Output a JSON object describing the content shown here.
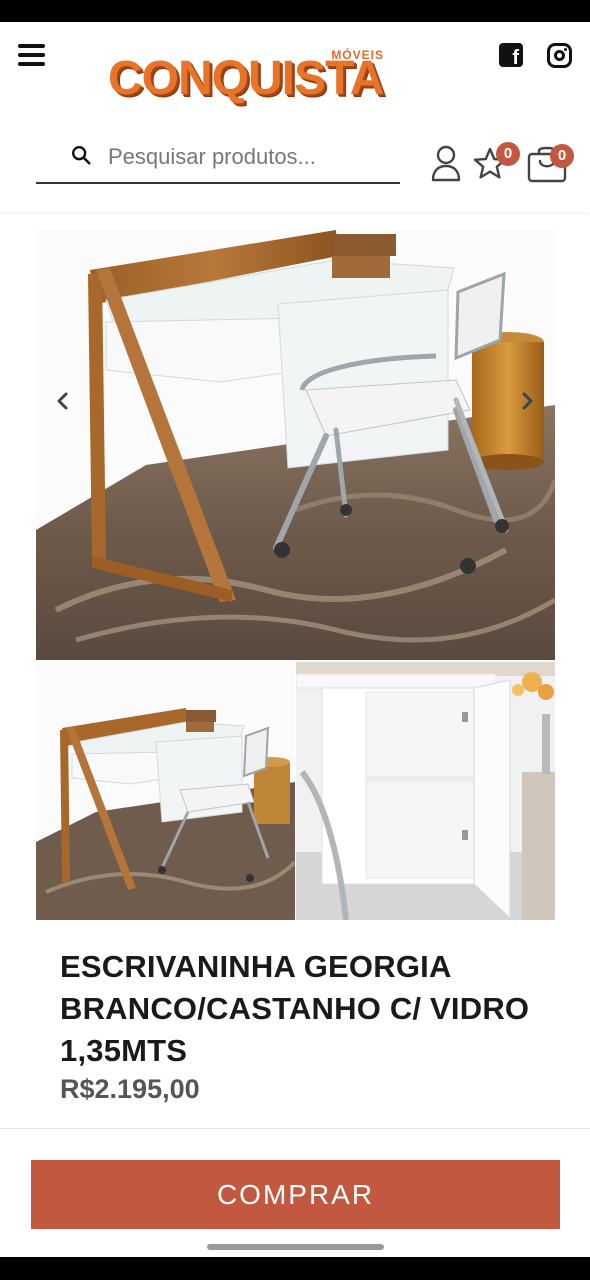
{
  "header": {
    "logo_small": "MÓVEIS",
    "logo_main": "CONQUISTA",
    "facebook_glyph": "f",
    "search": {
      "placeholder": "Pesquisar produtos..."
    },
    "wishlist_count": "0",
    "cart_count": "0"
  },
  "gallery": {
    "main_image": "desk-with-chair-on-rug",
    "thumbnails": [
      "desk-with-chair-on-rug",
      "desk-cabinet-open-detail"
    ]
  },
  "product": {
    "title": "ESCRIVANINHA GEORGIA BRANCO/CASTANHO C/ VIDRO 1,35MTS",
    "price": "R$2.195,00"
  },
  "actions": {
    "buy_label": "COMPRAR"
  },
  "colors": {
    "accent": "#c2583f",
    "logo_orange": "#e8742a"
  }
}
